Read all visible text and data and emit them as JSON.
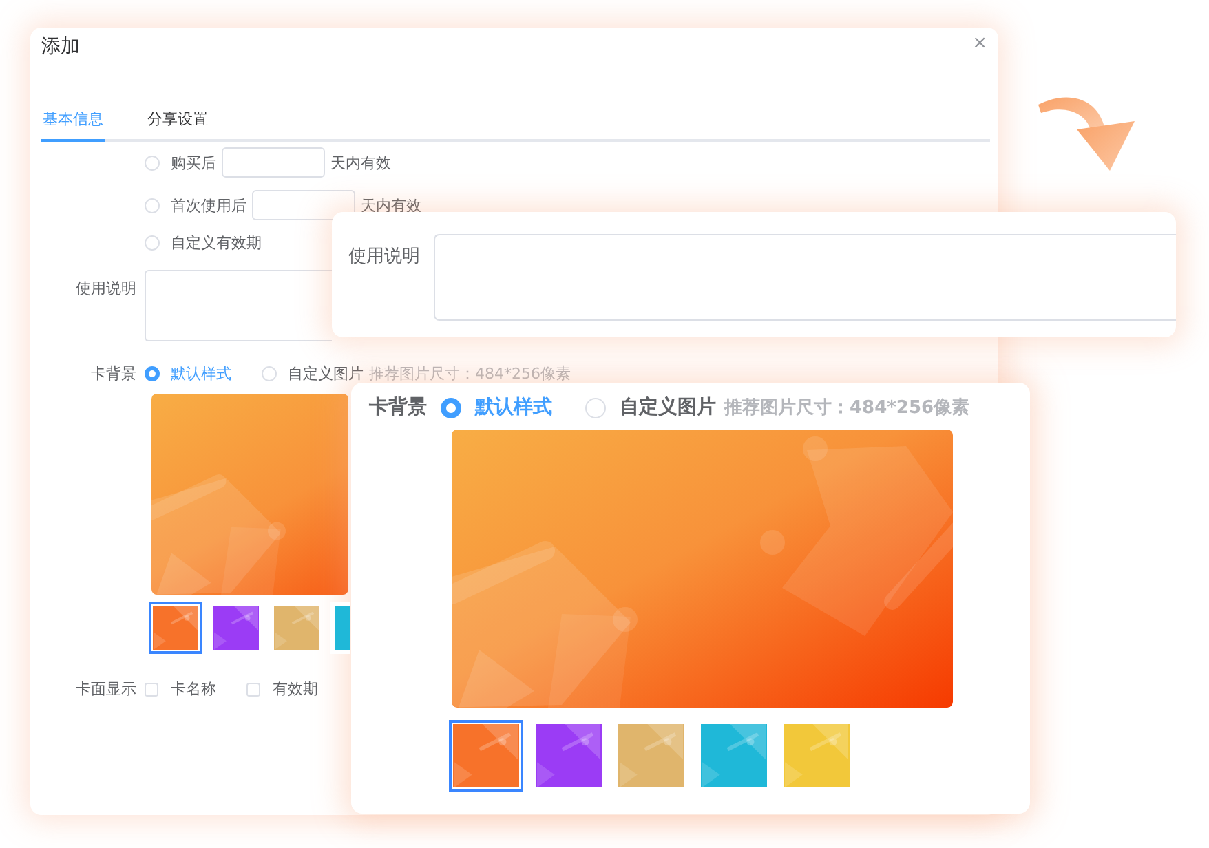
{
  "dialog": {
    "title": "添加",
    "close": "×",
    "tabs": [
      {
        "label": "基本信息",
        "selected": true
      },
      {
        "label": "分享设置",
        "selected": false
      }
    ],
    "validity_options": [
      {
        "kind": "days",
        "prefix": "购买后",
        "suffix": "天内有效",
        "selected": false
      },
      {
        "kind": "days",
        "prefix": "首次使用后",
        "suffix": "天内有效",
        "selected": false
      },
      {
        "kind": "custom",
        "label": "自定义有效期",
        "selected": false
      }
    ],
    "usage_label": "使用说明",
    "card_background": {
      "label": "卡背景",
      "options": [
        {
          "label": "默认样式",
          "selected": true
        },
        {
          "label": "自定义图片",
          "selected": false
        }
      ],
      "hint": "推荐图片尺寸：484*256像素",
      "swatches": [
        {
          "color": "#f7722a",
          "selected": true
        },
        {
          "color": "#9b3cf5",
          "selected": false
        },
        {
          "color": "#e0b56c",
          "selected": false
        },
        {
          "color": "#1fb8d8",
          "selected": false
        }
      ]
    },
    "card_face": {
      "label": "卡面显示",
      "options": [
        {
          "label": "卡名称",
          "checked": false
        },
        {
          "label": "有效期",
          "checked": false
        }
      ]
    }
  },
  "usage_callout": {
    "label": "使用说明"
  },
  "background_callout": {
    "label": "卡背景",
    "options": [
      {
        "label": "默认样式",
        "selected": true
      },
      {
        "label": "自定义图片",
        "selected": false
      }
    ],
    "hint": "推荐图片尺寸：484*256像素",
    "swatches": [
      {
        "color": "#f7722a",
        "selected": true
      },
      {
        "color": "#9b3cf5",
        "selected": false
      },
      {
        "color": "#e0b56c",
        "selected": false
      },
      {
        "color": "#1fb8d8",
        "selected": false
      },
      {
        "color": "#f2c83a",
        "selected": false
      }
    ]
  }
}
